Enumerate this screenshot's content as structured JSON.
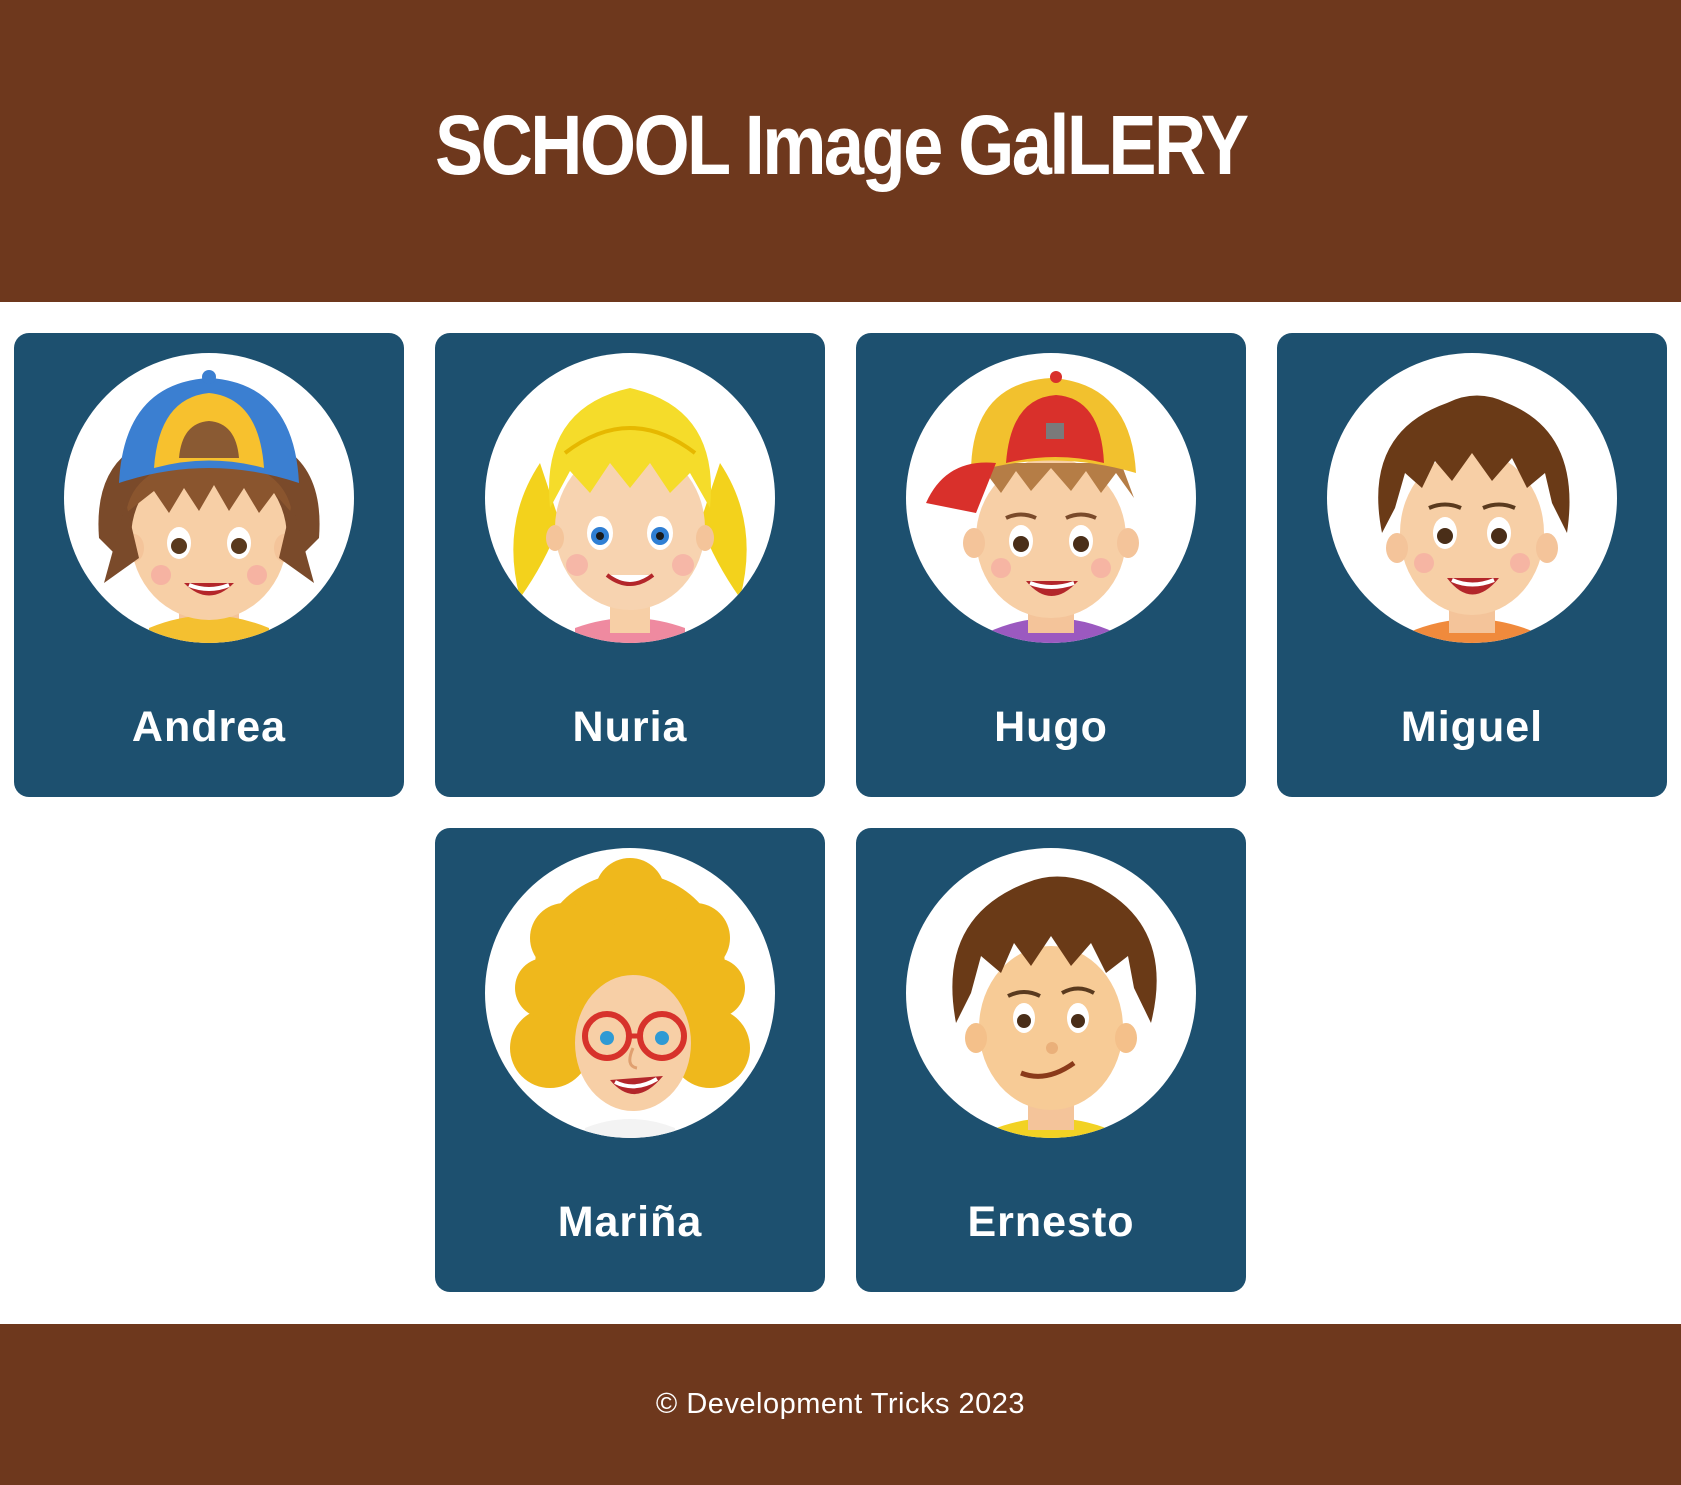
{
  "header": {
    "title": "SCHOOL Image GalLERY"
  },
  "students": [
    {
      "name": "Andrea",
      "avatar_icon": "girl-with-blue-cap-icon"
    },
    {
      "name": "Nuria",
      "avatar_icon": "blonde-girl-pigtails-icon"
    },
    {
      "name": "Hugo",
      "avatar_icon": "boy-with-red-cap-icon"
    },
    {
      "name": "Miguel",
      "avatar_icon": "brown-hair-boy-icon"
    },
    {
      "name": "Mariña",
      "avatar_icon": "curly-hair-girl-glasses-icon"
    },
    {
      "name": "Ernesto",
      "avatar_icon": "boy-brown-hair-smirk-icon"
    }
  ],
  "footer": {
    "text": "© Development Tricks 2023"
  },
  "colors": {
    "header_bg": "#6e381d",
    "card_bg": "#1d506f",
    "text": "#ffffff"
  }
}
